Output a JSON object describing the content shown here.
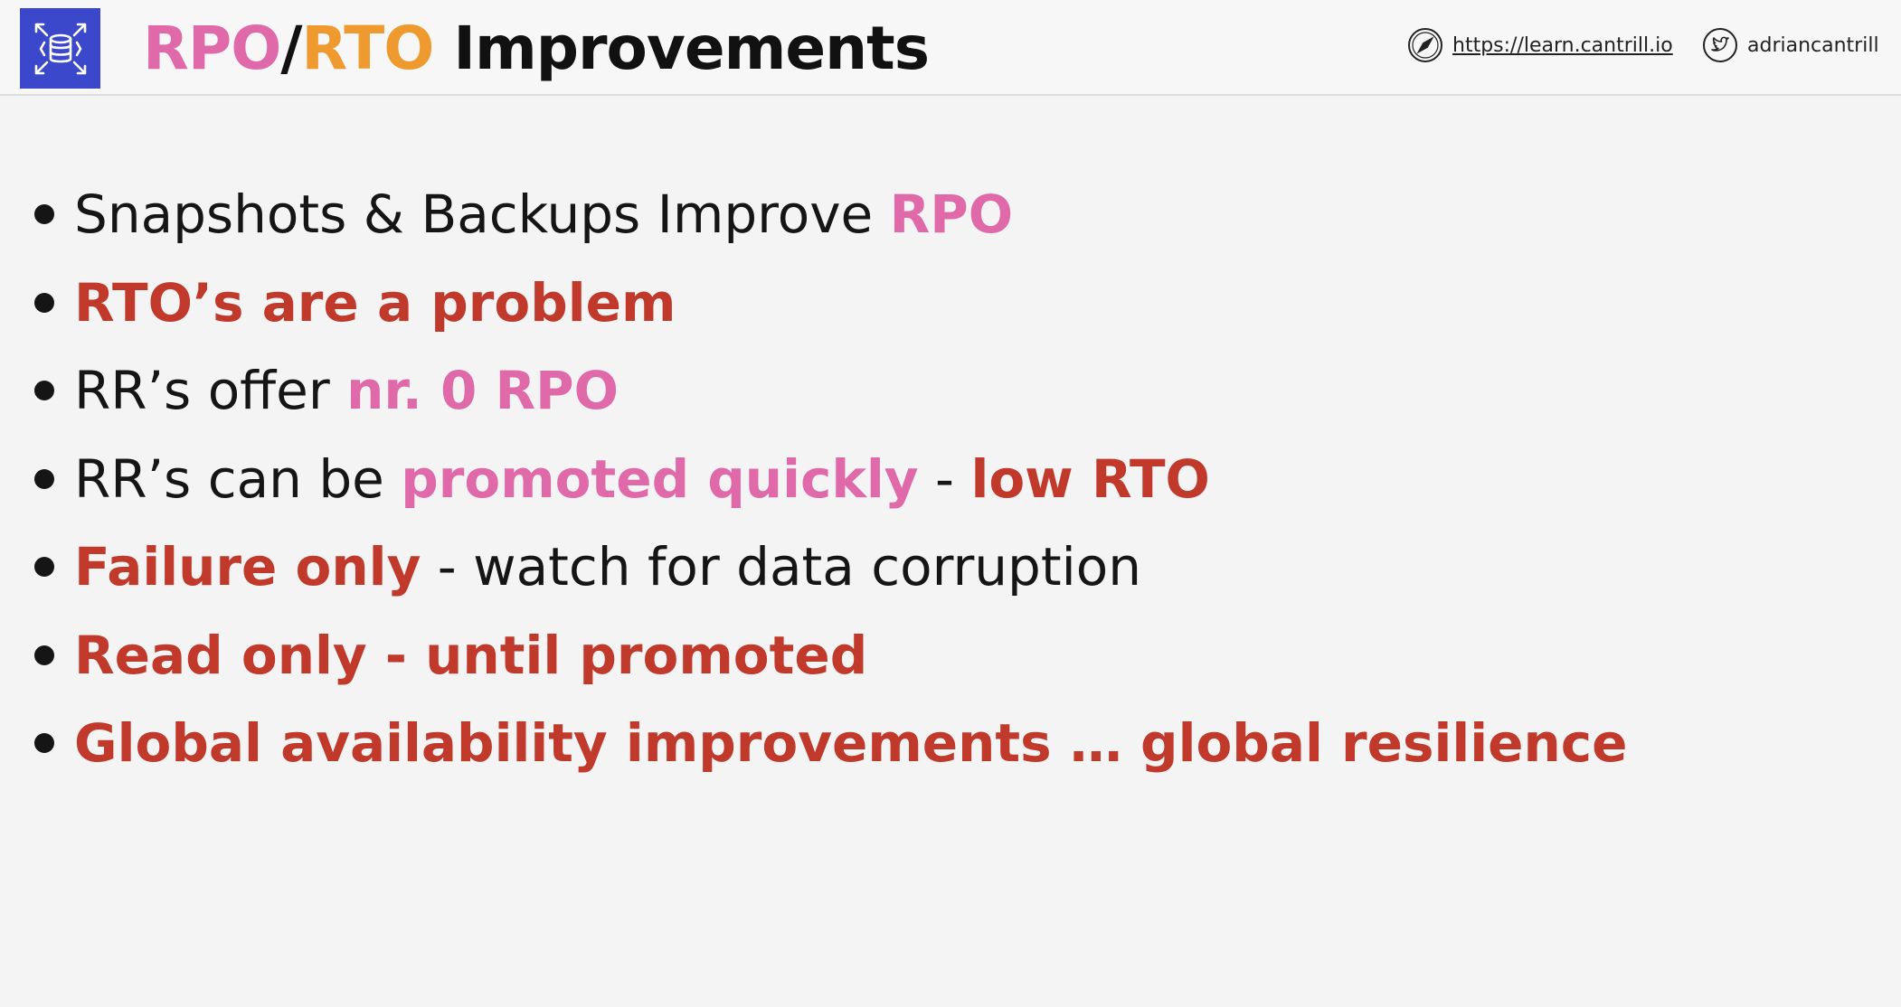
{
  "header": {
    "title_parts": [
      "RPO",
      "/",
      "RTO",
      " Improvements"
    ],
    "website_label": "https://learn.cantrill.io",
    "twitter_label": "adriancantrill"
  },
  "icons": {
    "logo": "aws-rds-database-icon",
    "website": "compass-icon",
    "twitter": "twitter-bird-icon"
  },
  "colors": {
    "accent_pink": "#e06aa9",
    "accent_orange": "#ef9a2f",
    "accent_red": "#c0392b",
    "logo_blue": "#3b48cc"
  },
  "bullets": [
    {
      "segments": [
        {
          "text": "Snapshots & Backups Improve ",
          "style": "plain"
        },
        {
          "text": "RPO",
          "style": "pink"
        }
      ]
    },
    {
      "segments": [
        {
          "text": "RTO’s are a problem",
          "style": "red"
        }
      ]
    },
    {
      "segments": [
        {
          "text": "RR’s offer ",
          "style": "plain"
        },
        {
          "text": "nr. 0 RPO",
          "style": "pink"
        }
      ]
    },
    {
      "segments": [
        {
          "text": "RR’s can be ",
          "style": "plain"
        },
        {
          "text": "promoted quickly",
          "style": "pink"
        },
        {
          "text": " - ",
          "style": "plain"
        },
        {
          "text": "low RTO",
          "style": "red"
        }
      ]
    },
    {
      "segments": [
        {
          "text": "Failure only",
          "style": "red"
        },
        {
          "text": " - watch for data corruption",
          "style": "plain"
        }
      ]
    },
    {
      "segments": [
        {
          "text": "Read only - until promoted",
          "style": "red"
        }
      ]
    },
    {
      "segments": [
        {
          "text": "Global availability improvements … global resilience",
          "style": "red"
        }
      ]
    }
  ]
}
